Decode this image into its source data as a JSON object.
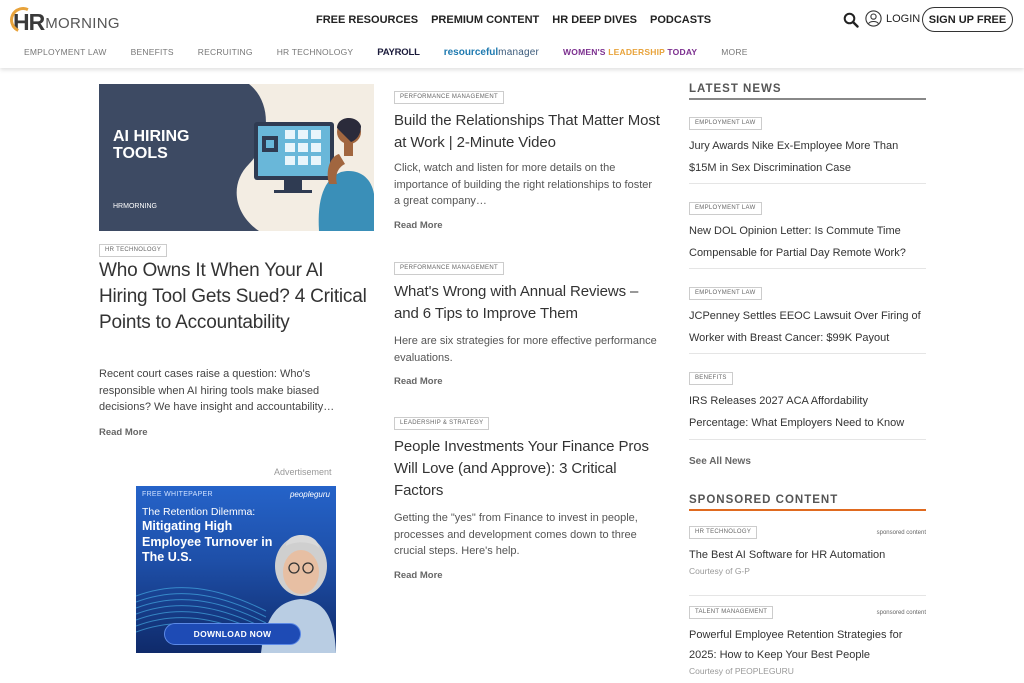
{
  "header": {
    "logo_hr": "HR",
    "logo_morning": "MORNING",
    "nav": [
      "FREE RESOURCES",
      "PREMIUM CONTENT",
      "HR DEEP DIVES",
      "PODCASTS"
    ],
    "login_label": "LOGIN",
    "signup_label": "SIGN UP FREE"
  },
  "subnav": {
    "employment_law": "EMPLOYMENT LAW",
    "benefits": "BENEFITS",
    "recruiting": "RECRUITING",
    "hr_technology": "HR TECHNOLOGY",
    "payroll": "PAYROLL",
    "rm_a": "resourceful",
    "rm_b": "manager",
    "wlt_a": "WOMEN'S ",
    "wlt_b": "LEADERSHIP",
    "wlt_c": " TODAY",
    "more": "MORE"
  },
  "lead": {
    "image_text": "AI HIRING TOOLS",
    "image_text_1": "AI HIRING",
    "image_text_2": "TOOLS",
    "image_logo": "HRMORNING",
    "tag": "HR TECHNOLOGY",
    "title": "Who Owns It When Your AI Hiring Tool Gets Sued? 4 Critical Points to Accountability",
    "excerpt": "Recent court cases raise a question: Who's responsible when AI hiring tools make biased decisions? We have insight and accountability…",
    "read_more": "Read More"
  },
  "ad": {
    "label": "Advertisement",
    "top": "FREE WHITEPAPER",
    "brand": "peopleguru",
    "head1": "The Retention Dilemma:",
    "head2": "Mitigating High Employee Turnover in The U.S.",
    "button": "DOWNLOAD NOW"
  },
  "middle": [
    {
      "tag": "PERFORMANCE MANAGEMENT",
      "title": "Build the Relationships That Matter Most at Work | 2-Minute Video",
      "excerpt": "Click, watch and listen for more details on the importance of building the right relationships to foster a great company…",
      "read_more": "Read More"
    },
    {
      "tag": "PERFORMANCE MANAGEMENT",
      "title": "What's Wrong with Annual Reviews – and 6 Tips to Improve Them",
      "excerpt": "Here are six strategies for more effective performance evaluations.",
      "read_more": "Read More"
    },
    {
      "tag": "LEADERSHIP & STRATEGY",
      "title": "People Investments Your Finance Pros Will Love (and Approve): 3 Critical Factors",
      "excerpt": "Getting the \"yes\" from Finance to invest in people, processes and development comes down to three crucial steps. Here's help.",
      "read_more": "Read More"
    }
  ],
  "latest": {
    "heading": "LATEST NEWS",
    "items": [
      {
        "tag": "EMPLOYMENT LAW",
        "title": "Jury Awards Nike Ex-Employee More Than $15M in Sex Discrimination Case"
      },
      {
        "tag": "EMPLOYMENT LAW",
        "title": "New DOL Opinion Letter: Is Commute Time Compensable for Partial Day Remote Work?"
      },
      {
        "tag": "EMPLOYMENT LAW",
        "title": "JCPenney Settles EEOC Lawsuit Over Firing of Worker with Breast Cancer: $99K Payout"
      },
      {
        "tag": "BENEFITS",
        "title": "IRS Releases 2027 ACA Affordability Percentage: What Employers Need to Know"
      }
    ],
    "see_all": "See All News"
  },
  "sponsored": {
    "heading": "SPONSORED CONTENT",
    "items": [
      {
        "tag": "HR TECHNOLOGY",
        "note": "sponsored content",
        "title": "The Best AI Software for HR Automation",
        "courtesy": "Courtesy of G-P"
      },
      {
        "tag": "TALENT MANAGEMENT",
        "note": "sponsored content",
        "title": "Powerful Employee Retention Strategies for 2025: How to Keep Your Best People",
        "courtesy": "Courtesy of PEOPLEGURU"
      }
    ]
  },
  "colors": {
    "accent_orange": "#e8a33b",
    "sponsored_rule": "#e06a1f",
    "hero_navy": "#3d4a63",
    "ad_blue": "#2563c9"
  },
  "icons": [
    "search-icon",
    "user-icon"
  ]
}
